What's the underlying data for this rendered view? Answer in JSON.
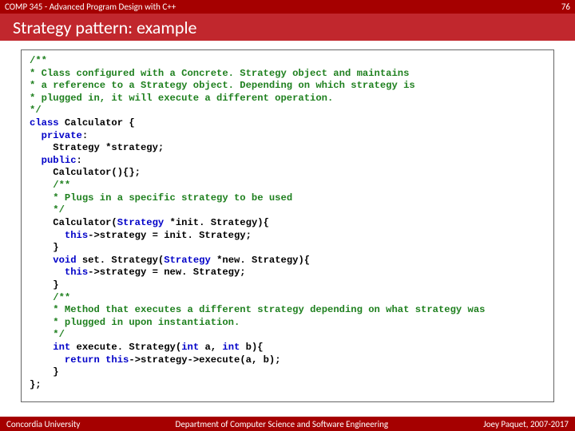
{
  "header": {
    "course": "COMP 345 - Advanced Program Design with C++",
    "slide_no": "76"
  },
  "title": "Strategy pattern: example",
  "code_lines": [
    [
      [
        "c",
        "/**"
      ]
    ],
    [
      [
        "c",
        "* Class configured with a Concrete. Strategy object and maintains"
      ]
    ],
    [
      [
        "c",
        "* a reference to a Strategy object. Depending on which strategy is"
      ]
    ],
    [
      [
        "c",
        "* plugged in, it will execute a different operation."
      ]
    ],
    [
      [
        "c",
        "*/"
      ]
    ],
    [
      [
        "k",
        "class"
      ],
      [
        "t",
        " Calculator {"
      ]
    ],
    [
      [
        "t",
        "  "
      ],
      [
        "k",
        "private"
      ],
      [
        "t",
        ":"
      ]
    ],
    [
      [
        "t",
        "    Strategy *strategy;"
      ]
    ],
    [
      [
        "t",
        "  "
      ],
      [
        "k",
        "public"
      ],
      [
        "t",
        ":"
      ]
    ],
    [
      [
        "t",
        "    Calculator(){};"
      ]
    ],
    [
      [
        "t",
        "    "
      ],
      [
        "c",
        "/**"
      ]
    ],
    [
      [
        "t",
        "    "
      ],
      [
        "c",
        "* Plugs in a specific strategy to be used"
      ]
    ],
    [
      [
        "t",
        "    "
      ],
      [
        "c",
        "*/"
      ]
    ],
    [
      [
        "t",
        "    Calculator("
      ],
      [
        "k",
        "Strategy"
      ],
      [
        "t",
        " *init. Strategy){"
      ]
    ],
    [
      [
        "t",
        "      "
      ],
      [
        "k",
        "this"
      ],
      [
        "t",
        "->strategy = init. Strategy;"
      ]
    ],
    [
      [
        "t",
        "    }"
      ]
    ],
    [
      [
        "t",
        "    "
      ],
      [
        "k",
        "void"
      ],
      [
        "t",
        " set. Strategy("
      ],
      [
        "k",
        "Strategy"
      ],
      [
        "t",
        " *new. Strategy){"
      ]
    ],
    [
      [
        "t",
        "      "
      ],
      [
        "k",
        "this"
      ],
      [
        "t",
        "->strategy = new. Strategy;"
      ]
    ],
    [
      [
        "t",
        "    }"
      ]
    ],
    [
      [
        "t",
        "    "
      ],
      [
        "c",
        "/**"
      ]
    ],
    [
      [
        "t",
        "    "
      ],
      [
        "c",
        "* Method that executes a different strategy depending on what strategy was"
      ]
    ],
    [
      [
        "t",
        "    "
      ],
      [
        "c",
        "* plugged in upon instantiation."
      ]
    ],
    [
      [
        "t",
        "    "
      ],
      [
        "c",
        "*/"
      ]
    ],
    [
      [
        "t",
        "    "
      ],
      [
        "k",
        "int"
      ],
      [
        "t",
        " execute. Strategy("
      ],
      [
        "k",
        "int"
      ],
      [
        "t",
        " a, "
      ],
      [
        "k",
        "int"
      ],
      [
        "t",
        " b){"
      ]
    ],
    [
      [
        "t",
        "      "
      ],
      [
        "k",
        "return"
      ],
      [
        "t",
        " "
      ],
      [
        "k",
        "this"
      ],
      [
        "t",
        "->strategy->execute(a, b);"
      ]
    ],
    [
      [
        "t",
        "    }"
      ]
    ],
    [
      [
        "t",
        "};"
      ]
    ]
  ],
  "footer": {
    "left": "Concordia University",
    "center": "Department of Computer Science and Software Engineering",
    "right": "Joey Paquet, 2007-2017"
  }
}
